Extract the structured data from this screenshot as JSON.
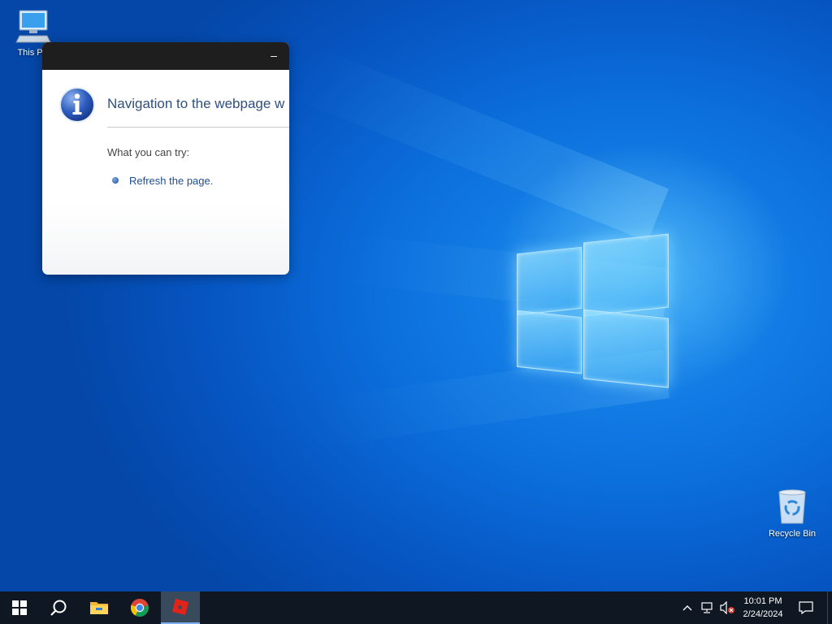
{
  "desktop": {
    "icons": [
      {
        "label": "This PC",
        "icon": "computer-icon"
      },
      {
        "label": "Recycle Bin",
        "icon": "recycle-bin-icon"
      }
    ]
  },
  "dialog": {
    "minimize_label": "–",
    "heading": "Navigation to the webpage w",
    "try_label": "What you can try:",
    "suggestion": "Refresh the page.",
    "icon": "info-icon"
  },
  "taskbar": {
    "apps": [
      {
        "name": "Start",
        "icon": "windows-start-icon"
      },
      {
        "name": "Search",
        "icon": "search-icon"
      },
      {
        "name": "File Explorer",
        "icon": "folder-icon"
      },
      {
        "name": "Google Chrome",
        "icon": "chrome-icon"
      },
      {
        "name": "Roblox",
        "icon": "roblox-icon",
        "active": true
      }
    ],
    "tray": {
      "icons": [
        "chevron-up-icon",
        "network-icon",
        "volume-muted-icon",
        "notification-icon"
      ],
      "time": "10:01 PM",
      "date": "2/24/2024"
    }
  },
  "colors": {
    "desktop_blue": "#0b6fdc",
    "taskbar": "#0f1822",
    "dialog_titlebar": "#1e1e1e",
    "link_blue": "#1f4f8f"
  }
}
